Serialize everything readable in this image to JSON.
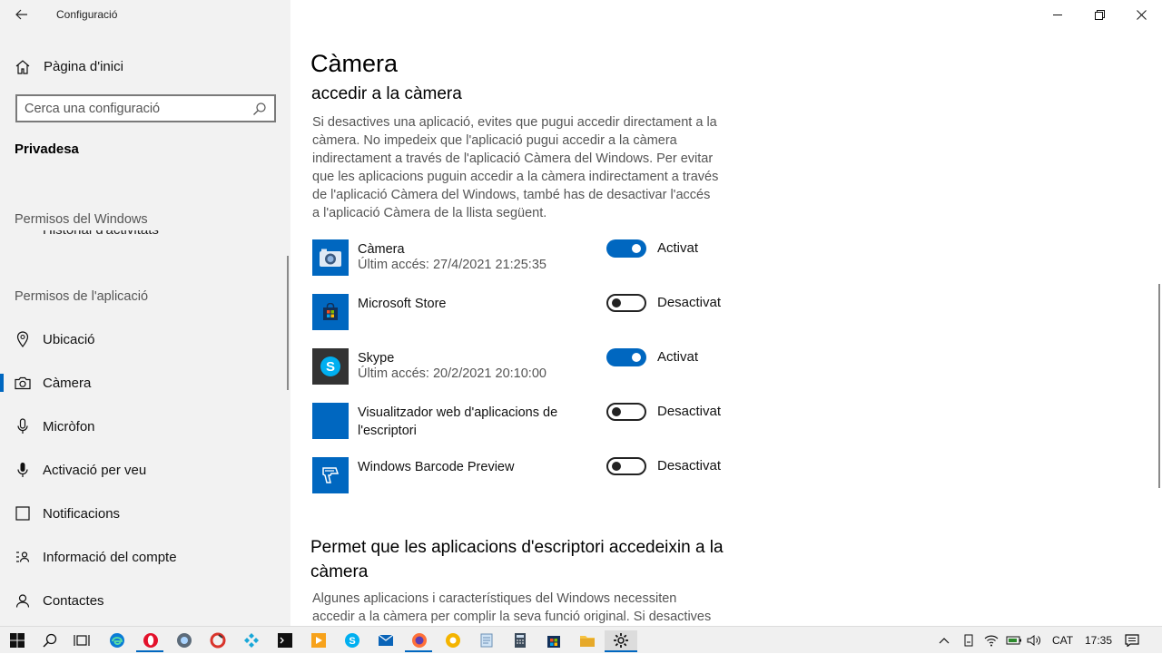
{
  "window": {
    "title": "Configuració",
    "controls": [
      "minimize",
      "restore",
      "close"
    ]
  },
  "sidebar": {
    "home_label": "Pàgina d'inici",
    "search_placeholder": "Cerca una configuració",
    "section_title": "Privadesa",
    "group_windows": "Permisos del Windows",
    "clipped_item": "Historial d'activitats",
    "group_apps": "Permisos de l'aplicació",
    "items": [
      {
        "label": "Ubicació",
        "icon": "location-icon"
      },
      {
        "label": "Càmera",
        "icon": "camera-icon",
        "active": true
      },
      {
        "label": "Micròfon",
        "icon": "microphone-icon"
      },
      {
        "label": "Activació per veu",
        "icon": "voice-icon"
      },
      {
        "label": "Notificacions",
        "icon": "notification-icon"
      },
      {
        "label": "Informació del compte",
        "icon": "account-info-icon"
      },
      {
        "label": "Contactes",
        "icon": "contacts-icon"
      }
    ]
  },
  "main": {
    "title": "Càmera",
    "subheading": "accedir a la càmera",
    "description": "Si desactives una aplicació, evites que pugui accedir directament a la càmera. No impedeix que l'aplicació pugui accedir a la càmera indirectament a través de l'aplicació Càmera del Windows. Per evitar que les aplicacions puguin accedir a la càmera indirectament a través de l'aplicació Càmera del Windows, també has de desactivar l'accés a l'aplicació Càmera de la llista següent.",
    "apps": [
      {
        "name": "Càmera",
        "sub": "Últim accés: 27/4/2021 21:25:35",
        "state": "on",
        "state_label": "Activat"
      },
      {
        "name": "Microsoft Store",
        "sub": "",
        "state": "off",
        "state_label": "Desactivat"
      },
      {
        "name": "Skype",
        "sub": "Últim accés: 20/2/2021 20:10:00",
        "state": "on",
        "state_label": "Activat"
      },
      {
        "name": "Visualitzador web d'aplicacions de l'escriptori",
        "sub": "",
        "state": "off",
        "state_label": "Desactivat"
      },
      {
        "name": "Windows Barcode Preview",
        "sub": "",
        "state": "off",
        "state_label": "Desactivat"
      }
    ],
    "heading2": "Permet que les aplicacions d'escriptori accedeixin a la càmera",
    "description2": "Algunes aplicacions i característiques del Windows necessiten accedir a la càmera per complir la seva funció original. Si desactives"
  },
  "taskbar": {
    "tray": {
      "language": "CAT",
      "time": "17:35"
    }
  },
  "colors": {
    "accent": "#0067c0",
    "sidebar_bg": "#f2f2f2"
  }
}
